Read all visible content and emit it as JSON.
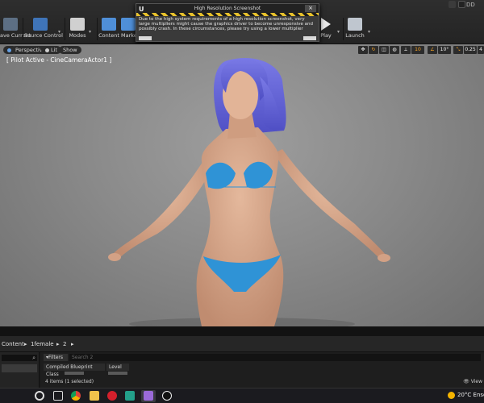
{
  "toolbar": {
    "save_current": "ave Current",
    "source_control": "Source Control",
    "modes": "Modes",
    "content": "Content",
    "marketplace": "Market",
    "play": "Play",
    "launch": "Launch",
    "corner_dd": "DD"
  },
  "dialog": {
    "logo": "U",
    "title": "High Resolution Screenshot",
    "close": "×",
    "message": "Due to the high system requirements of a high resolution screenshot, very large multipliers might cause the graphics driver to become unresponsive and possibly crash. In these circumstances, please try using a lower multiplier"
  },
  "viewport": {
    "perspective": "Perspective",
    "lit": "Lit",
    "show": "Show",
    "pilot": "[ Pilot Active - CineCameraActor1 ]",
    "grid_value": "10",
    "angle_value": "10°",
    "scale_value": "0.25",
    "cam_speed": "4"
  },
  "content_browser": {
    "crumb_root": "Content",
    "crumb_folder1": "1female",
    "crumb_folder2": "2",
    "filters": "Filters",
    "search_placeholder": "Search 2",
    "columns": [
      "Compiled Blueprint Class",
      "Level"
    ],
    "item_count": "4 items (1 selected)",
    "view_options": "View"
  },
  "taskbar": {
    "temperature": "20°C",
    "weather": "Ensol"
  },
  "colors": {
    "hair": "#6b6bd6",
    "bikini": "#2f93d6",
    "skin": "#d9a88b",
    "accent_orange": "#f3a024"
  }
}
